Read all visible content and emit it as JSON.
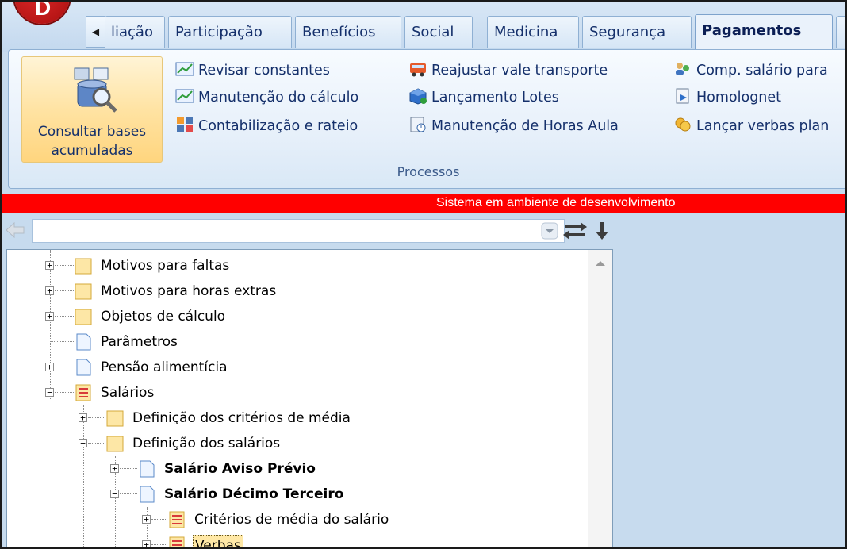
{
  "app": {
    "logo_letter": "D"
  },
  "tabs": [
    {
      "label": "liação"
    },
    {
      "label": "Participação"
    },
    {
      "label": "Benefícios"
    },
    {
      "label": "Social"
    },
    {
      "label": "Medicina"
    },
    {
      "label": "Segurança"
    },
    {
      "label": "Pagamentos",
      "active": true
    }
  ],
  "ribbon": {
    "big_button": {
      "label_line1": "Consultar bases",
      "label_line2": "acumuladas"
    },
    "items": [
      {
        "label": "Revisar constantes",
        "icon": "chart-icon"
      },
      {
        "label": "Manutenção do cálculo",
        "icon": "chart-icon"
      },
      {
        "label": "Contabilização e rateio",
        "icon": "calculator-icon"
      },
      {
        "label": "Reajustar vale transporte",
        "icon": "bus-icon"
      },
      {
        "label": "Lançamento Lotes",
        "icon": "cube-icon"
      },
      {
        "label": "Manutenção de Horas Aula",
        "icon": "clock-doc-icon"
      },
      {
        "label": "Comp. salário para",
        "icon": "people-icon"
      },
      {
        "label": "Homolognet",
        "icon": "doc-arrow-icon"
      },
      {
        "label": "Lançar verbas plan",
        "icon": "coins-icon"
      }
    ],
    "group_label": "Processos"
  },
  "status_message": "Sistema em ambiente de desenvolvimento",
  "search": {
    "value": ""
  },
  "tree": [
    {
      "label": "Motivos para faltas"
    },
    {
      "label": "Motivos para horas extras"
    },
    {
      "label": "Objetos de cálculo"
    },
    {
      "label": "Parâmetros"
    },
    {
      "label": "Pensão alimentícia"
    },
    {
      "label": "Salários"
    },
    {
      "label": "Definição dos critérios de média"
    },
    {
      "label": "Definição dos salários"
    },
    {
      "label": "Salário Aviso Prévio"
    },
    {
      "label": "Salário Décimo Terceiro"
    },
    {
      "label": "Critérios de média do salário"
    },
    {
      "label": "Verbas",
      "selected": true
    }
  ]
}
